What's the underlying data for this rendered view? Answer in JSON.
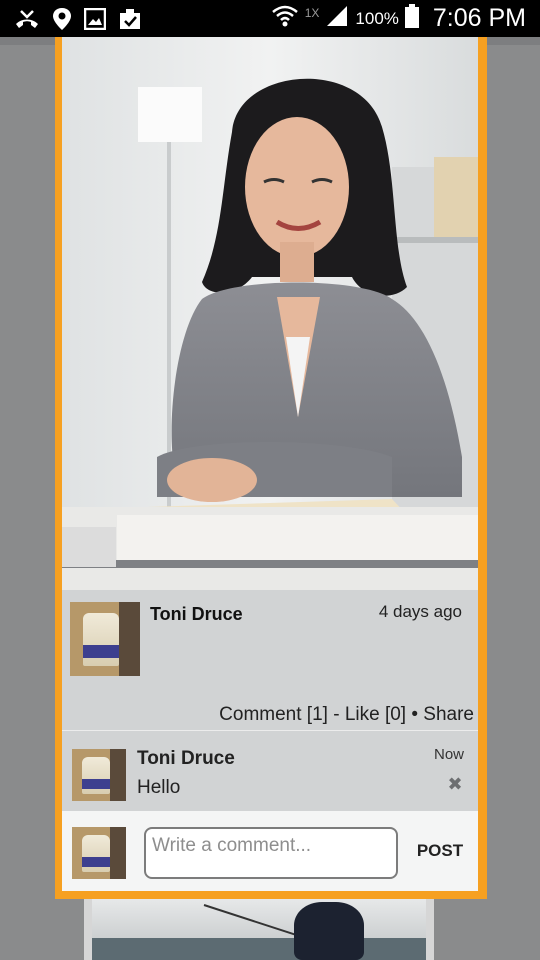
{
  "status_bar": {
    "icons_left": [
      "missed-call-icon",
      "location-icon",
      "image-icon",
      "clipboard-check-icon"
    ],
    "network_label": "1X",
    "battery": "100%",
    "time": "7:06 PM"
  },
  "post": {
    "author": "Toni Druce",
    "time": "4 days ago",
    "actions": {
      "comment": "Comment [1]",
      "sep1": " - ",
      "like": "Like [0]",
      "sep2": " • ",
      "share": "Share"
    }
  },
  "comments": [
    {
      "author": "Toni Druce",
      "text": "Hello",
      "time": "Now"
    }
  ],
  "composer": {
    "placeholder": "Write a comment...",
    "post_label": "POST"
  },
  "colors": {
    "accent": "#f6a021",
    "panel": "#d1d3d4",
    "composer_bg": "#f4f5f5"
  }
}
